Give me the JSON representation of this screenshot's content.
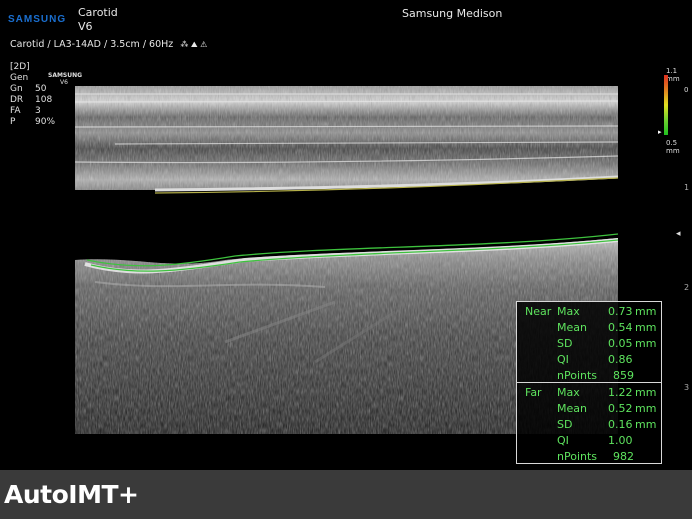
{
  "header": {
    "brand": "SAMSUNG",
    "preset": "Carotid",
    "system": "V6",
    "manufacturer": "Samsung Medison",
    "probe_line": "Carotid / LA3-14AD / 3.5cm / 60Hz"
  },
  "params": {
    "mode": "[2D]",
    "gen_label": "Gen",
    "watermark_brand": "SAMSUNG",
    "watermark_model": "V6",
    "rows": [
      {
        "label": "Gn",
        "value": "50"
      },
      {
        "label": "DR",
        "value": "108"
      },
      {
        "label": "FA",
        "value": "3"
      },
      {
        "label": "P",
        "value": "90%"
      }
    ]
  },
  "scale": {
    "top": "1.1 mm",
    "mid": "0",
    "bottom": "0.5 mm"
  },
  "ruler": [
    "1",
    "2",
    "3"
  ],
  "measurements": {
    "near": {
      "label": "Near",
      "rows": [
        {
          "key": "Max",
          "value": "0.73",
          "unit": "mm"
        },
        {
          "key": "Mean",
          "value": "0.54",
          "unit": "mm"
        },
        {
          "key": "SD",
          "value": "0.05",
          "unit": "mm"
        },
        {
          "key": "QI",
          "value": "0.86",
          "unit": ""
        },
        {
          "key": "nPoints",
          "value": "859",
          "unit": ""
        }
      ]
    },
    "far": {
      "label": "Far",
      "rows": [
        {
          "key": "Max",
          "value": "1.22",
          "unit": "mm"
        },
        {
          "key": "Mean",
          "value": "0.52",
          "unit": "mm"
        },
        {
          "key": "SD",
          "value": "0.16",
          "unit": "mm"
        },
        {
          "key": "QI",
          "value": "1.00",
          "unit": ""
        },
        {
          "key": "nPoints",
          "value": "982",
          "unit": ""
        }
      ]
    }
  },
  "footer": {
    "title": "AutoIMT+"
  },
  "colors": {
    "brand_blue": "#1a6fd0",
    "measure_green": "#5ee35e",
    "footer_bg": "#3a3a3a"
  }
}
